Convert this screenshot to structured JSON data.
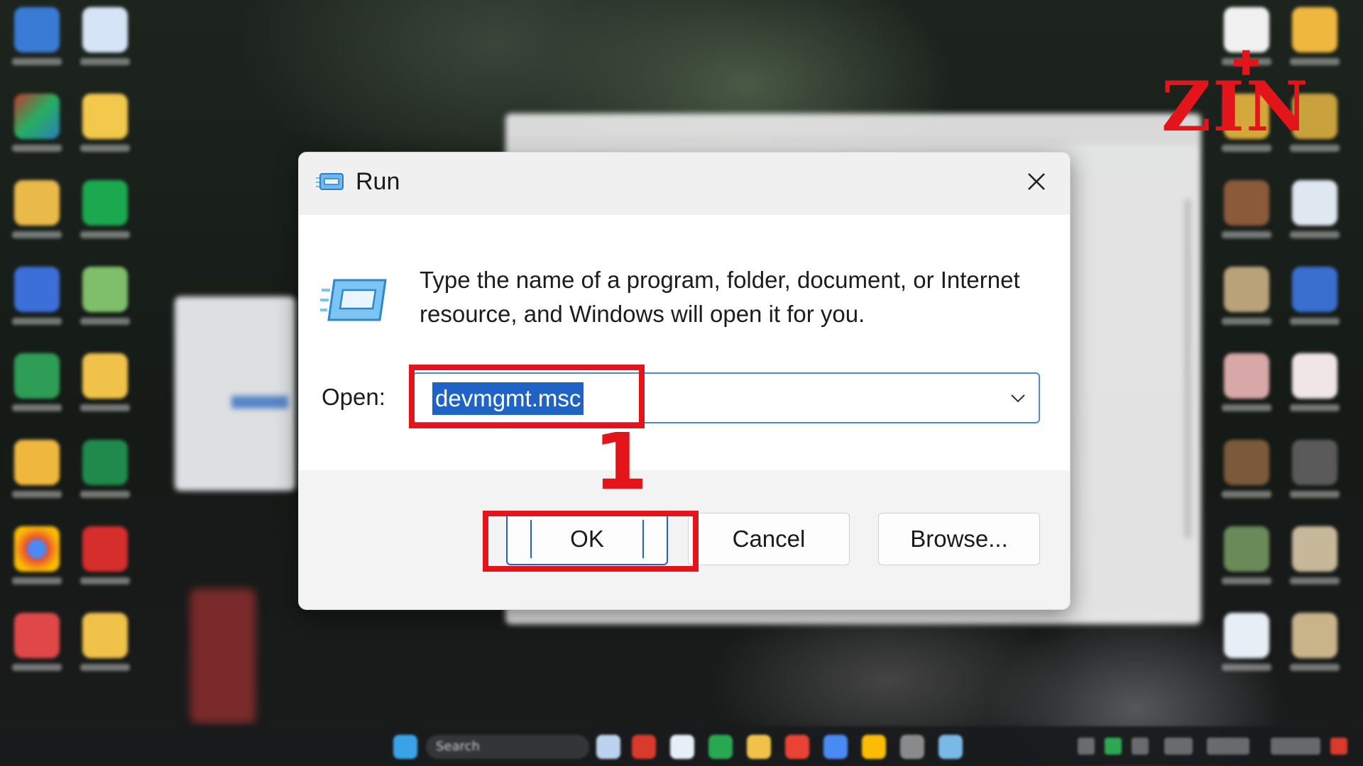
{
  "dialog": {
    "title": "Run",
    "description": "Type the name of a program, folder, document, or Internet resource, and Windows will open it for you.",
    "open_label": "Open:",
    "open_value": "devmgmt.msc",
    "buttons": {
      "ok": "OK",
      "cancel": "Cancel",
      "browse": "Browse..."
    }
  },
  "annotation": {
    "step_number": "1",
    "color": "#e3151b"
  },
  "watermark": {
    "text": "ZIN"
  },
  "taskbar": {
    "search_text": "Search"
  },
  "icons": {
    "dialog_app": "run-icon",
    "close": "close-icon",
    "dropdown": "chevron-down-icon"
  },
  "colors": {
    "accent": "#1f63c6",
    "annotation": "#e3151b"
  }
}
